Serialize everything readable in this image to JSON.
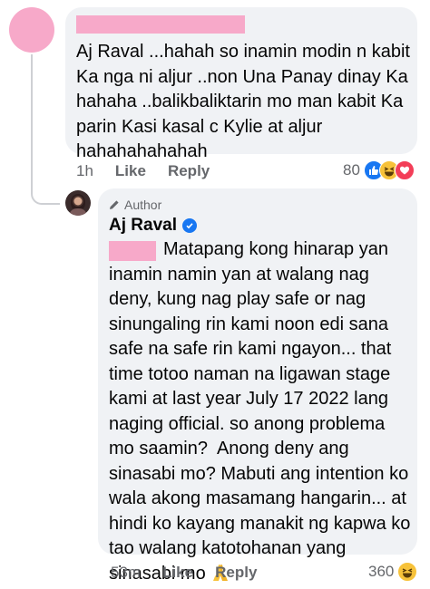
{
  "comment": {
    "text": "Aj Raval ...hahah so inamin modin n kabit\nKa nga ni aljur ..non Una Panay dinay Ka\nhahaha ..balikbaliktarin mo man kabit Ka\nparin Kasi kasal c Kylie at aljur\nhahahahahahah",
    "time": "1h",
    "like_label": "Like",
    "reply_label": "Reply",
    "reaction_count": "80",
    "reactions": [
      "like-icon",
      "haha-icon",
      "love-icon"
    ]
  },
  "reply": {
    "author_tag": "Author",
    "name": "Aj Raval",
    "text": "Matapang kong hinarap yan\ninamin namin yan at walang nag\ndeny, kung nag play safe or nag\nsinungaling rin kami noon edi sana\nsafe na safe rin kami ngayon... that\ntime totoo naman na ligawan stage\nkami at last year July 17 2022 lang\nnaging official. so anong problema\nmo saamin?  Anong deny ang\nsinasabi mo? Mabuti ang intention ko\nwala akong masamang hangarin... at\nhindi ko kayang manakit ng kapwa ko\ntao walang katotohanan yang\nsinasabi mo ",
    "time": "53m",
    "like_label": "Like",
    "reply_label": "Reply",
    "reaction_count": "360",
    "reactions": [
      "haha-icon"
    ]
  },
  "colors": {
    "redaction": "#f7a9c9",
    "bubble": "#f0f2f5",
    "like_blue": "#1877f2",
    "muted": "#65676b"
  }
}
